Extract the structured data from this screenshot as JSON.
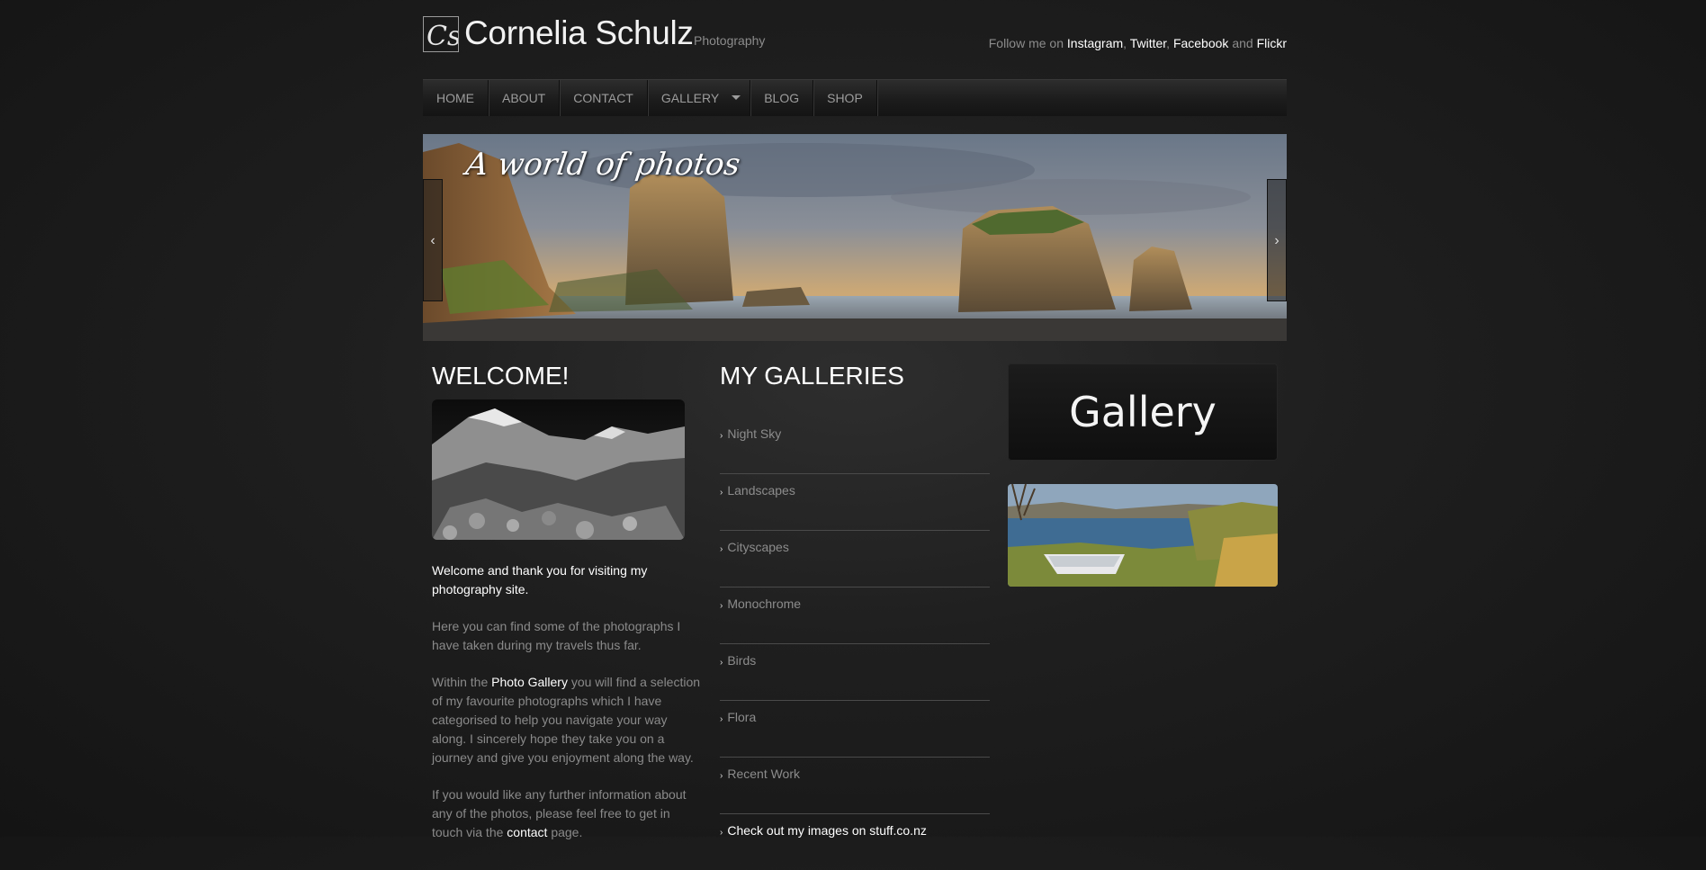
{
  "header": {
    "logo_text": "Cs",
    "title": "Cornelia Schulz",
    "subtitle": "Photography",
    "social_prefix": "Follow me on",
    "social_links": [
      "Instagram",
      "Twitter",
      "Facebook",
      "Flickr"
    ],
    "social_and": "and"
  },
  "nav": {
    "items": [
      "HOME",
      "ABOUT",
      "CONTACT",
      "GALLERY",
      "BLOG",
      "SHOP"
    ]
  },
  "slider": {
    "caption": "A world of photos",
    "prev_glyph": "‹",
    "next_glyph": "›"
  },
  "welcome": {
    "heading": "WELCOME!",
    "intro": "Welcome and thank you for visiting my photography site.",
    "para1": "Here you can find some of the photographs I have taken during my travels thus far.",
    "para2_before": "Within the",
    "para2_link": "Photo Gallery",
    "para2_after": "you will find a selection of my favourite photographs which I have categorised to help you navigate your way along. I sincerely hope they take you on a journey and give you enjoyment along the way.",
    "para3_before": "If you would like any further information about any of the photos, please feel free to get in touch via the",
    "para3_link": "contact",
    "para3_after": "page."
  },
  "galleries": {
    "heading": "MY GALLERIES",
    "items": [
      "Night Sky",
      "Landscapes",
      "Cityscapes",
      "Monochrome",
      "Birds",
      "Flora",
      "Recent Work"
    ],
    "external": "Check out my images on stuff.co.nz"
  },
  "sidebar": {
    "banner_text": "Gallery"
  }
}
